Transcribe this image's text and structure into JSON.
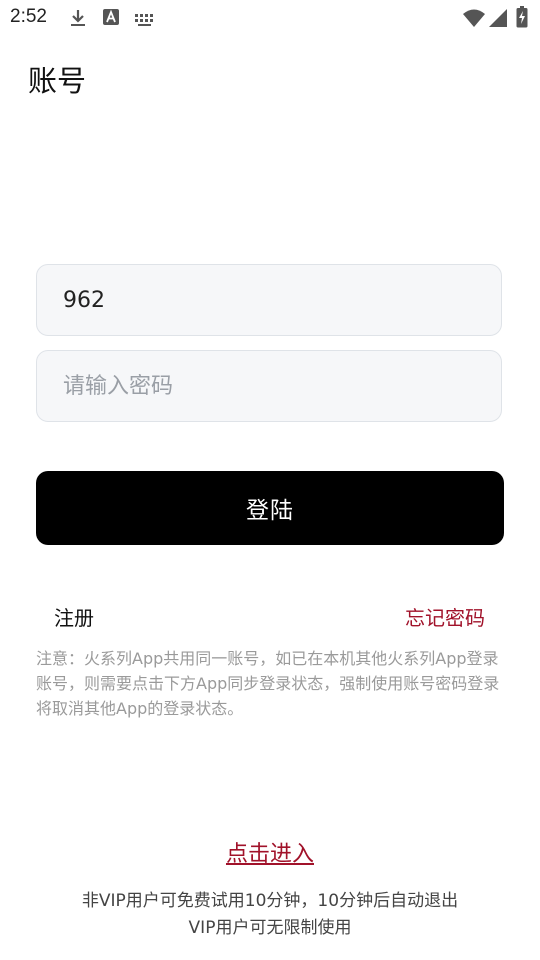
{
  "status_bar": {
    "time": "2:52",
    "icons": [
      "download-icon",
      "text-a-icon",
      "keyboard-icon",
      "wifi-icon",
      "signal-icon",
      "battery-charging-icon"
    ]
  },
  "page": {
    "title": "账号"
  },
  "form": {
    "account_value": "962",
    "password_placeholder": "请输入密码",
    "login_label": "登陆",
    "register_label": "注册",
    "forgot_label": "忘记密码"
  },
  "notice": {
    "text": "注意：火系列App共用同一账号，如已在本机其他火系列App登录账号，则需要点击下方App同步登录状态，强制使用账号密码登录将取消其他App的登录状态。"
  },
  "footer": {
    "enter_link": "点击进入",
    "line1": "非VIP用户可免费试用10分钟，10分钟后自动退出",
    "line2": "VIP用户可无限制使用"
  },
  "colors": {
    "accent": "#a1122a",
    "button_bg": "#000000",
    "field_bg": "#f6f7f9",
    "field_border": "#dfe3e8"
  }
}
